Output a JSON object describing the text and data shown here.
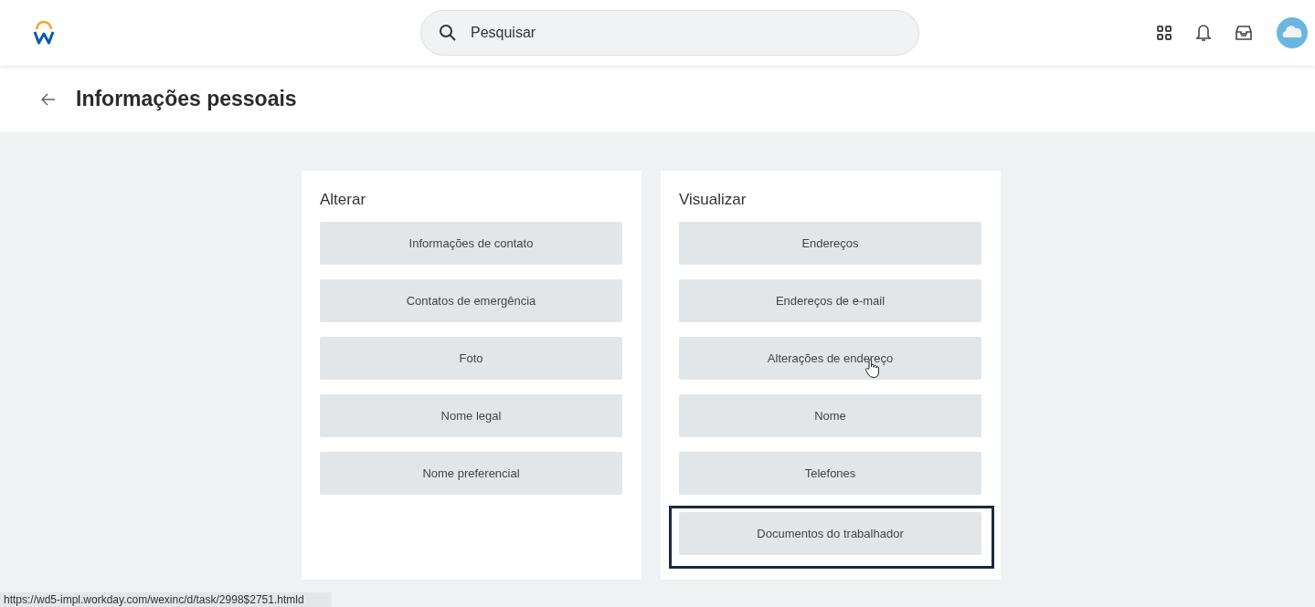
{
  "search": {
    "placeholder": "Pesquisar"
  },
  "page_title": "Informações pessoais",
  "cards": [
    {
      "title": "Alterar",
      "items": [
        {
          "label": "Informações de contato",
          "highlighted": false,
          "hovered": false
        },
        {
          "label": "Contatos de emergência",
          "highlighted": false,
          "hovered": false
        },
        {
          "label": "Foto",
          "highlighted": false,
          "hovered": false
        },
        {
          "label": "Nome legal",
          "highlighted": false,
          "hovered": false
        },
        {
          "label": "Nome preferencial",
          "highlighted": false,
          "hovered": false
        }
      ]
    },
    {
      "title": "Visualizar",
      "items": [
        {
          "label": "Endereços",
          "highlighted": false,
          "hovered": false
        },
        {
          "label": "Endereços de e-mail",
          "highlighted": false,
          "hovered": false
        },
        {
          "label": "Alterações de endereço",
          "highlighted": false,
          "hovered": true
        },
        {
          "label": "Nome",
          "highlighted": false,
          "hovered": false
        },
        {
          "label": "Telefones",
          "highlighted": false,
          "hovered": false
        },
        {
          "label": "Documentos do trabalhador",
          "highlighted": true,
          "hovered": false
        }
      ]
    }
  ],
  "status_bar": "https://wd5-impl.workday.com/wexinc/d/task/2998$2751.htmld"
}
